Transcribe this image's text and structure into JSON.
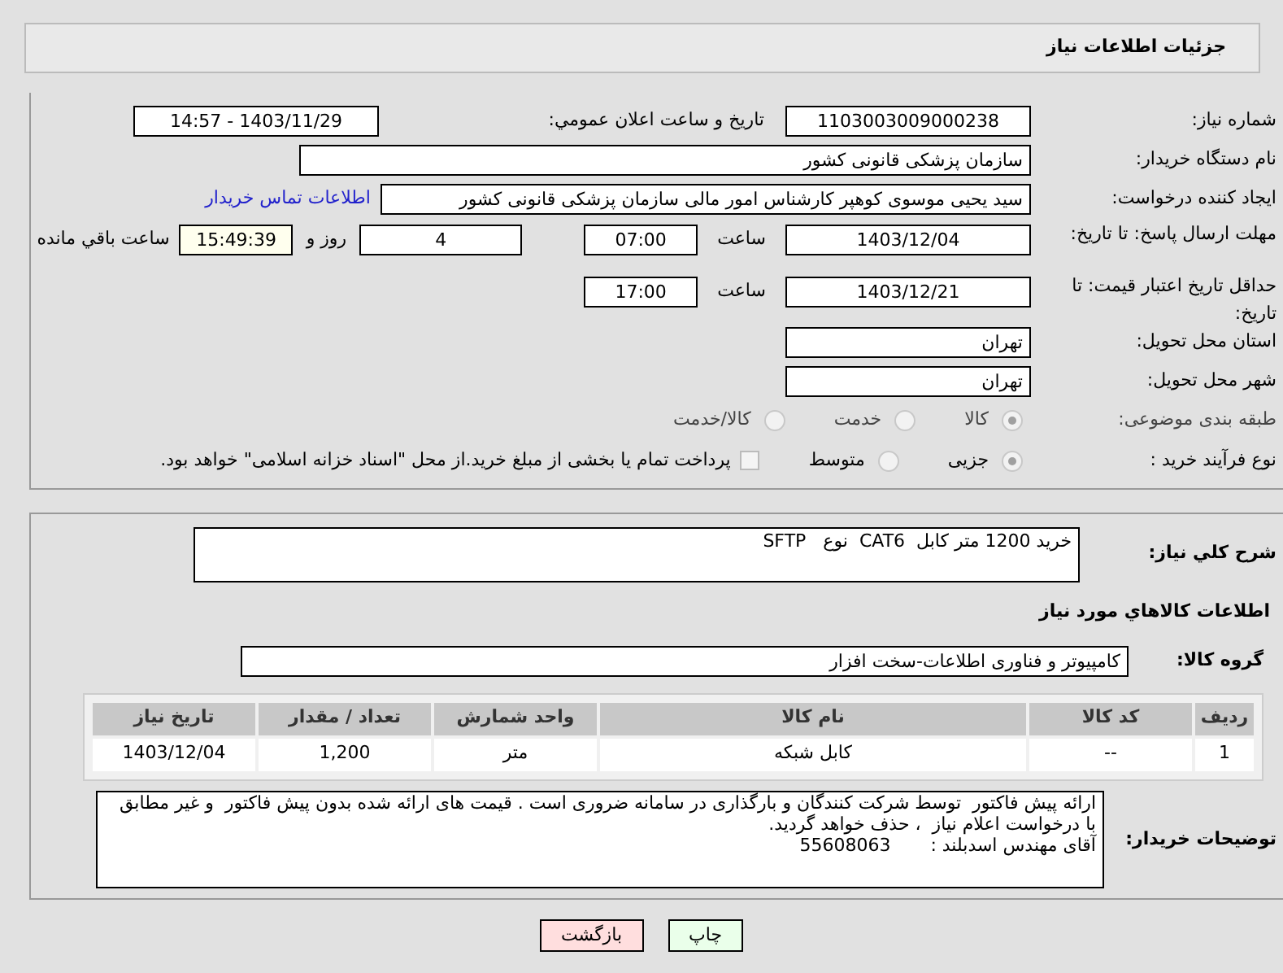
{
  "title": "جزئیات اطلاعات نیاز",
  "need_number": {
    "label": "شماره نیاز:",
    "value": "1103003009000238"
  },
  "announce": {
    "label": "تاریخ و ساعت اعلان عمومي:",
    "value": "1403/11/29 - 14:57"
  },
  "buyer": {
    "label": "نام دستگاه خریدار:",
    "value": "سازمان پزشکی قانونی کشور"
  },
  "creator": {
    "label": "ایجاد کننده درخواست:",
    "value": "سید یحیی موسوی کوهپر کارشناس امور مالی سازمان پزشکی قانونی کشور",
    "link": "اطلاعات تماس خریدار"
  },
  "deadline": {
    "label": "مهلت ارسال پاسخ: تا تاریخ:",
    "date": "1403/12/04",
    "time_label": "ساعت",
    "time": "07:00",
    "days": "4",
    "days_label": "روز و",
    "remaining": "15:49:39",
    "remaining_label": "ساعت باقي مانده"
  },
  "validity": {
    "label": "حداقل تاریخ اعتبار قیمت: تا تاریخ:",
    "date": "1403/12/21",
    "time_label": "ساعت",
    "time": "17:00"
  },
  "province": {
    "label": "استان محل تحویل:",
    "value": "تهران"
  },
  "city": {
    "label": "شهر محل تحویل:",
    "value": "تهران"
  },
  "category": {
    "label": "طبقه بندی موضوعی:",
    "options": [
      {
        "label": "کالا",
        "selected": true
      },
      {
        "label": "خدمت",
        "selected": false
      },
      {
        "label": "کالا/خدمت",
        "selected": false
      }
    ]
  },
  "process": {
    "label": "نوع فرآیند خرید :",
    "options": [
      {
        "label": "جزیی",
        "selected": true
      },
      {
        "label": "متوسط",
        "selected": false
      }
    ],
    "treasury": {
      "label": "پرداخت تمام یا بخشی از مبلغ خرید.از محل \"اسناد خزانه اسلامی\" خواهد بود.",
      "checked": false
    }
  },
  "summary": {
    "label": "شرح کلي نیاز:",
    "value": "خرید 1200 متر کابل  CAT6  نوع   SFTP"
  },
  "goods_heading": "اطلاعات کالاهاي مورد نياز",
  "goods_group": {
    "label": "گروه کالا:",
    "value": "کامپیوتر و فناوری اطلاعات-سخت افزار"
  },
  "table": {
    "columns": [
      "ردیف",
      "کد کالا",
      "نام کالا",
      "واحد شمارش",
      "تعداد / مقدار",
      "تاریخ نیاز"
    ],
    "rows": [
      [
        "1",
        "--",
        "کابل شبکه",
        "متر",
        "1,200",
        "1403/12/04"
      ]
    ]
  },
  "notes": {
    "label": "توضیحات خریدار:",
    "lines": [
      "ارائه پیش فاکتور  توسط شرکت کنندگان و بارگذاری در سامانه ضروری است . قیمت های ارائه شده بدون پیش فاکتور  و غیر مطابق با درخواست اعلام نیاز  ، حذف خواهد گردید.",
      "آقای مهندس اسدبلند :       55608063"
    ]
  },
  "buttons": [
    {
      "label": "چاپ",
      "kind": "print"
    },
    {
      "label": "بازگشت",
      "kind": "back"
    }
  ]
}
